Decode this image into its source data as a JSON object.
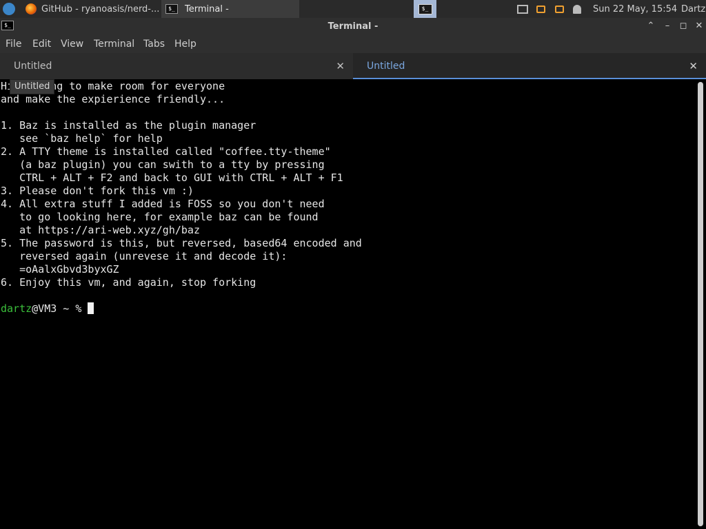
{
  "panel": {
    "task_github": "GitHub - ryanoasis/nerd-...",
    "task_terminal": "Terminal -",
    "clock": "Sun 22 May, 15:54",
    "user": "Dartz",
    "terminal_icon_text": "$_"
  },
  "window": {
    "title": "Terminal -",
    "minimize": "–",
    "maximize": "◻",
    "close": "✕"
  },
  "menu": {
    "file": "File",
    "edit": "Edit",
    "view": "View",
    "terminal": "Terminal",
    "tabs": "Tabs",
    "help": "Help"
  },
  "tabs": [
    {
      "label": "Untitled",
      "close": "✕"
    },
    {
      "label": "Untitled",
      "close": "✕"
    }
  ],
  "tooltip": "Untitled",
  "terminal": {
    "lines": [
      "Hi, trying to make room for everyone",
      "and make the expierience friendly...",
      "",
      "1. Baz is installed as the plugin manager",
      "   see `baz help` for help",
      "2. A TTY theme is installed called \"coffee.tty-theme\"",
      "   (a baz plugin) you can swith to a tty by pressing",
      "   CTRL + ALT + F2 and back to GUI with CTRL + ALT + F1",
      "3. Please don't fork this vm :)",
      "4. All extra stuff I added is FOSS so you don't need",
      "   to go looking here, for example baz can be found",
      "   at https://ari-web.xyz/gh/baz",
      "5. The password is this, but reversed, based64 encoded and",
      "   reversed again (unrevese it and decode it):",
      "   =oAalxGbvd3byxGZ",
      "6. Enjoy this vm, and again, stop forking",
      ""
    ],
    "prompt_user": "dartz",
    "prompt_rest": "@VM3 ~ % "
  }
}
